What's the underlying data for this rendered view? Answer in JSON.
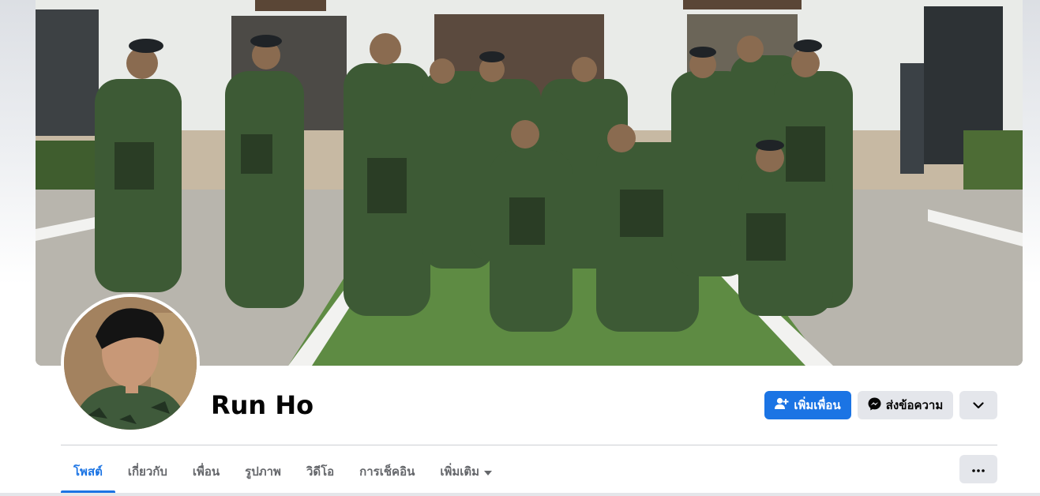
{
  "profile": {
    "name": "Run Ho"
  },
  "actions": {
    "add_friend_label": "เพิ่มเพื่อน",
    "message_label": "ส่งข้อความ"
  },
  "tabs": [
    {
      "label": "โพสต์",
      "active": true
    },
    {
      "label": "เกี่ยวกับ",
      "active": false
    },
    {
      "label": "เพื่อน",
      "active": false
    },
    {
      "label": "รูปภาพ",
      "active": false
    },
    {
      "label": "วิดีโอ",
      "active": false
    },
    {
      "label": "การเช็คอิน",
      "active": false
    },
    {
      "label": "เพิ่มเติม",
      "active": false
    }
  ],
  "icons": {
    "add_friend": "person-plus-icon",
    "message": "messenger-icon",
    "dropdown": "chevron-down-icon",
    "more_tab_caret": "caret-down-icon",
    "overflow": "ellipsis-icon"
  },
  "colors": {
    "accent": "#1b74e4",
    "button_secondary": "#e4e6eb",
    "text_primary": "#050505",
    "text_secondary": "#65676b"
  }
}
